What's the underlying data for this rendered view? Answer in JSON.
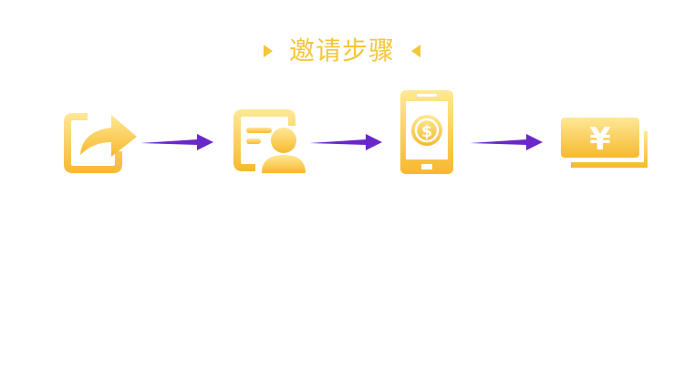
{
  "title": "邀请步骤",
  "colors": {
    "gold_light": "#ffe58a",
    "gold_dark": "#f5b82e",
    "arrow": "#6a28c8"
  },
  "steps": [
    {
      "icon": "share-icon"
    },
    {
      "icon": "profile-card-icon"
    },
    {
      "icon": "mobile-payment-icon"
    },
    {
      "icon": "cash-yuan-icon"
    }
  ]
}
